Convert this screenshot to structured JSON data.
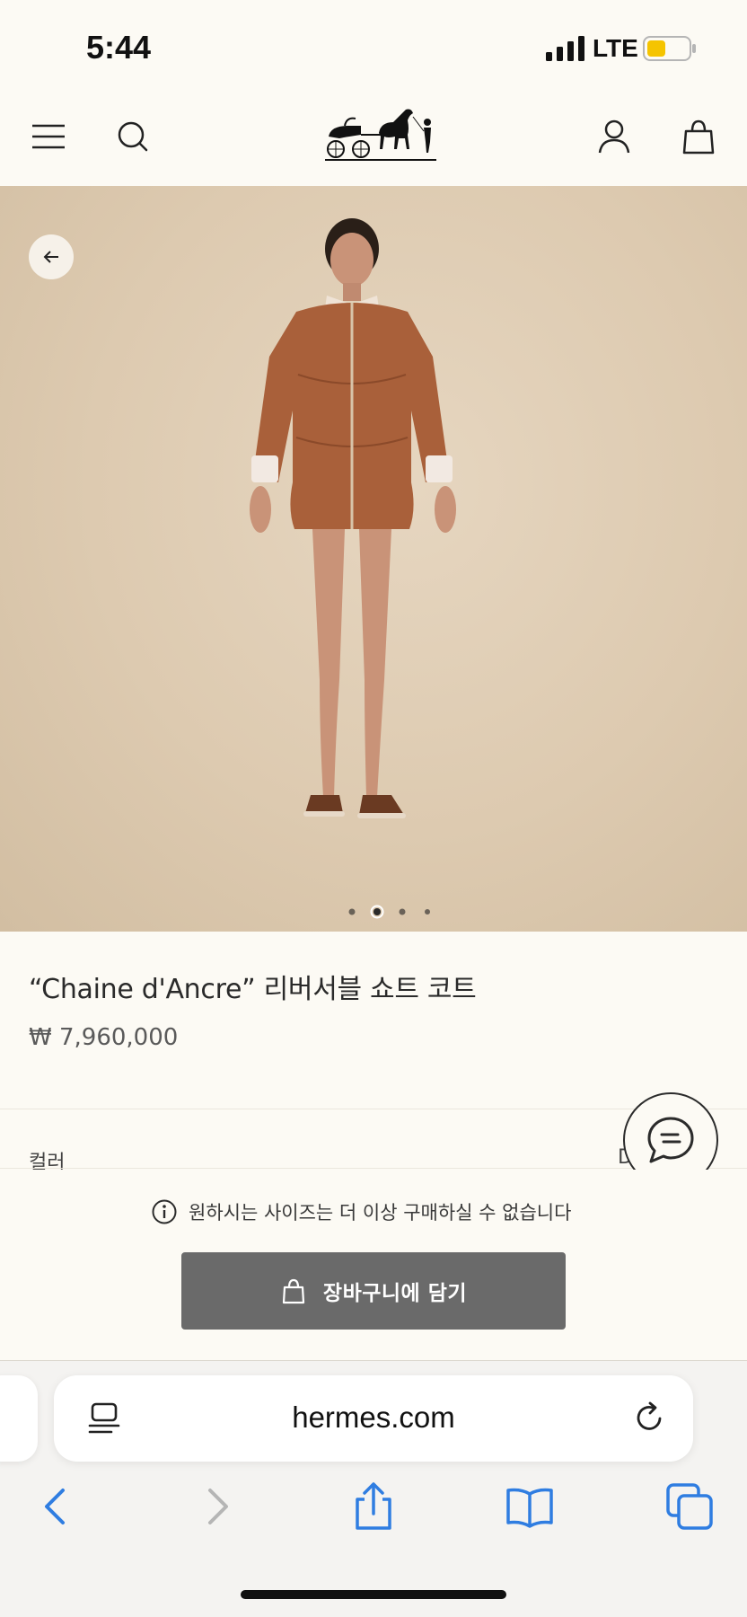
{
  "status_bar": {
    "time": "5:44",
    "network": "LTE",
    "battery_color": "#f5c400"
  },
  "header": {
    "menu_icon": "menu-icon",
    "search_icon": "search-icon",
    "logo": "hermes-carriage-logo",
    "account_icon": "account-icon",
    "bag_icon": "shopping-bag-icon"
  },
  "hero": {
    "back_icon": "arrow-left-icon",
    "carousel_total": 4,
    "carousel_active_index": 1
  },
  "product": {
    "name": "“Chaine d'Ancre” 리버서블 쇼트 코트",
    "price": "₩ 7,960,000",
    "color_label": "컬러",
    "color_value": "D"
  },
  "purchase": {
    "notice": "원하시는 사이즈는 더 이상 구매하실 수 없습니다",
    "add_to_cart": "장바구니에 담기",
    "button_color": "#6a6a6a"
  },
  "browser": {
    "url": "hermes.com",
    "accent_color": "#2f7de1"
  }
}
